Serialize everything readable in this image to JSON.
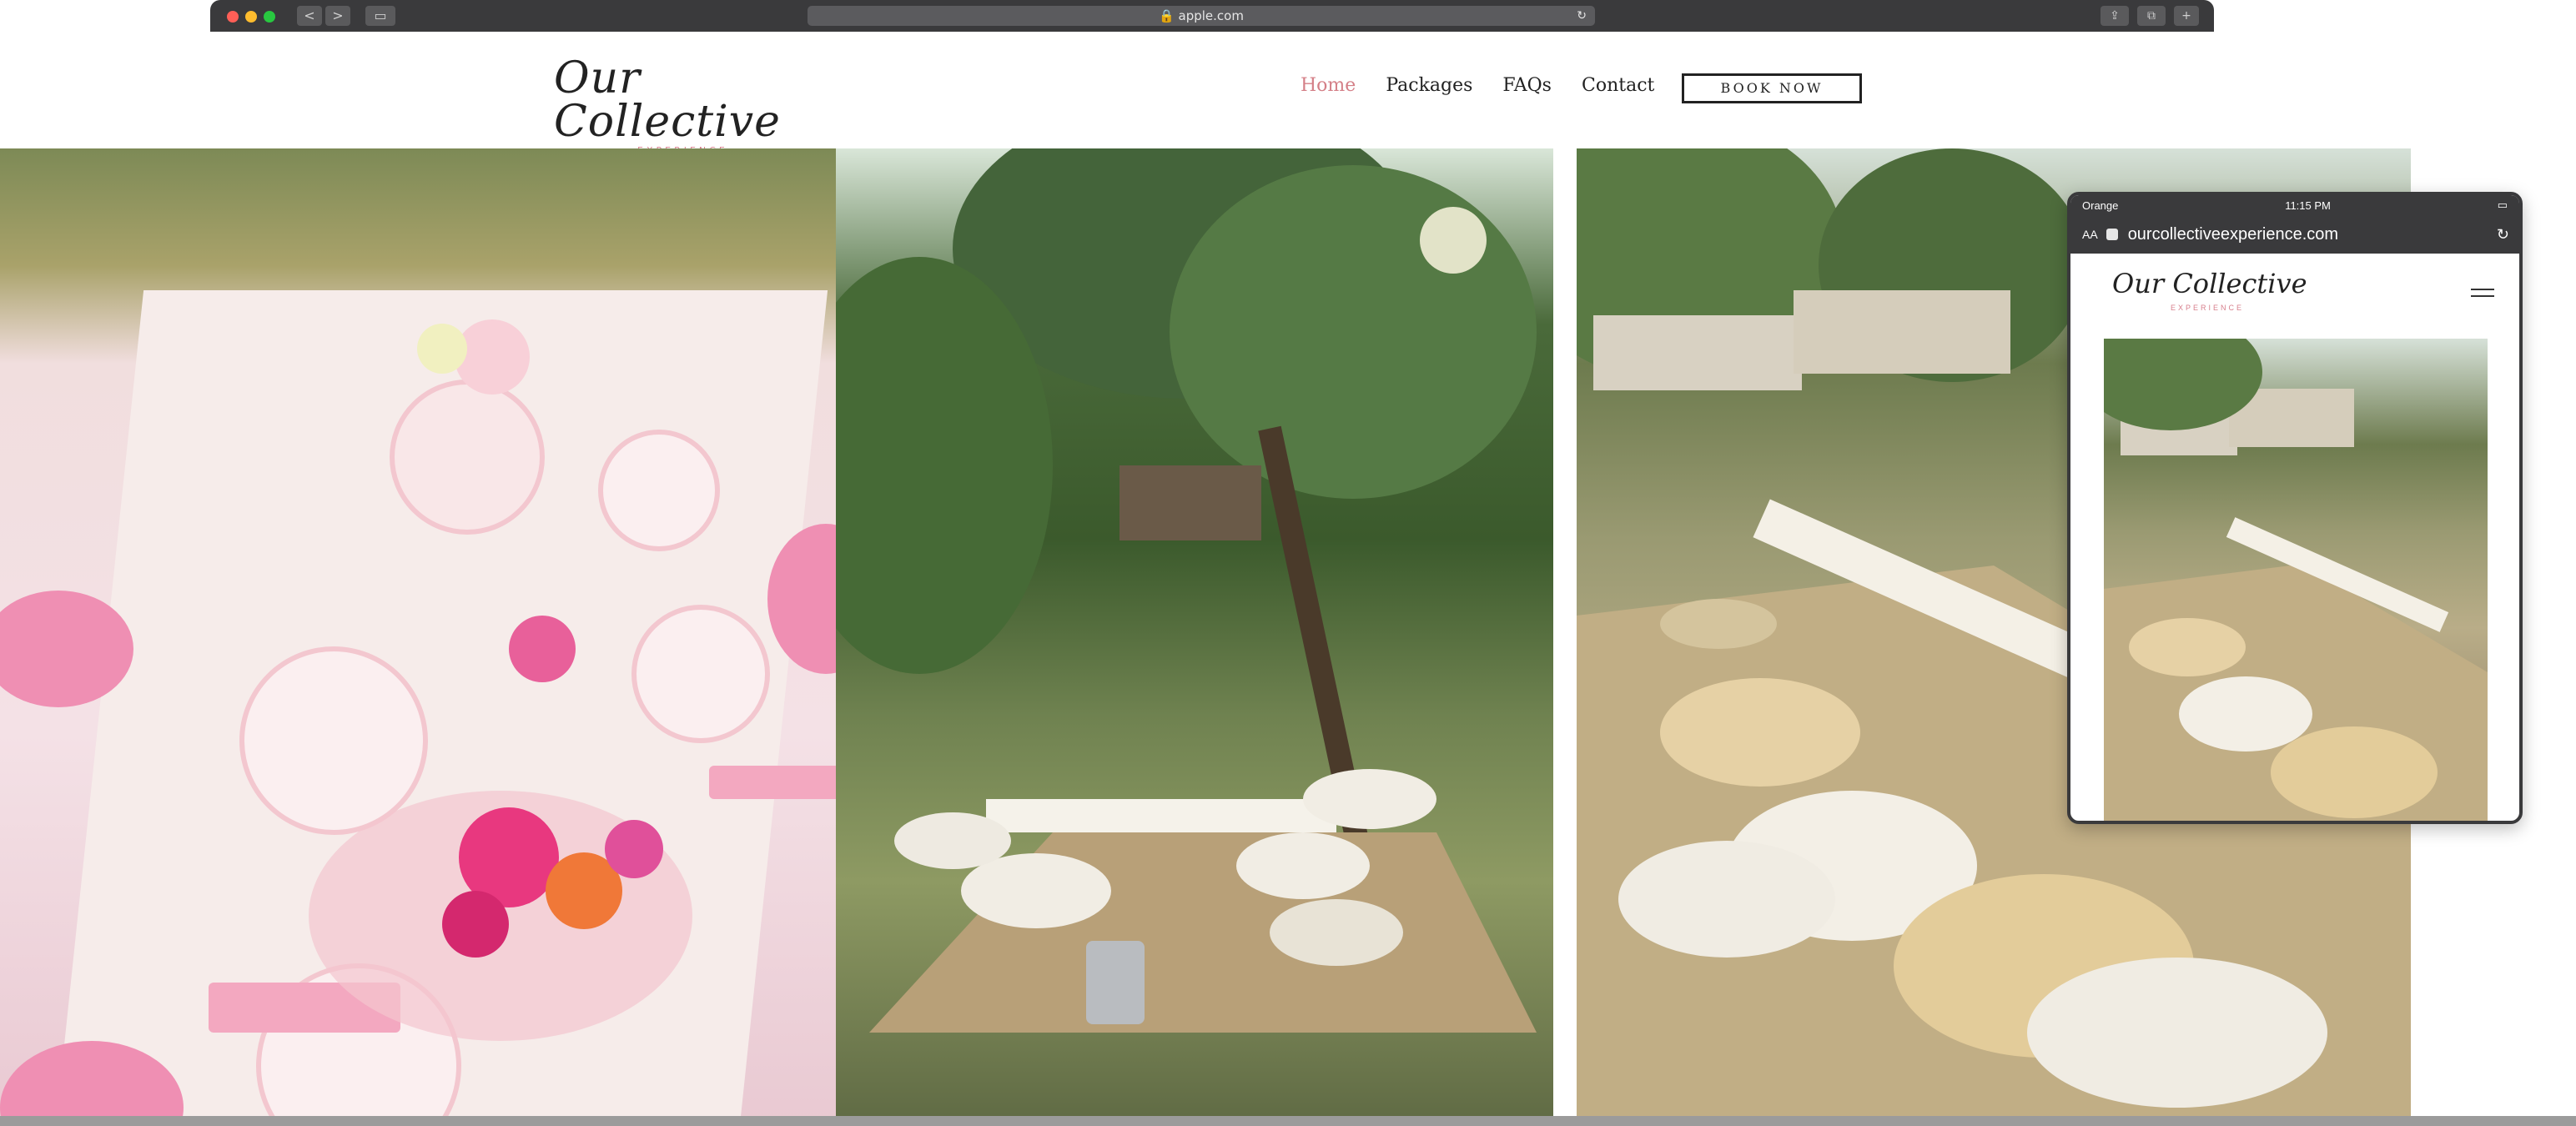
{
  "browser": {
    "url": "apple.com",
    "back": "<",
    "forward": ">"
  },
  "site": {
    "logo_script": "Our Collective",
    "logo_sub": "EXPERIENCE",
    "nav": [
      {
        "label": "Home",
        "active": true
      },
      {
        "label": "Packages",
        "active": false
      },
      {
        "label": "FAQs",
        "active": false
      },
      {
        "label": "Contact",
        "active": false
      }
    ],
    "cta": "BOOK NOW"
  },
  "phone": {
    "carrier": "Orange",
    "time": "11:15 PM",
    "aa": "AA",
    "url": "ourcollectiveexperience.com",
    "logo_script": "Our Collective",
    "logo_sub": "EXPERIENCE"
  },
  "colors": {
    "accent": "#d47f87",
    "chrome": "#3a3a3c",
    "text": "#222222"
  }
}
